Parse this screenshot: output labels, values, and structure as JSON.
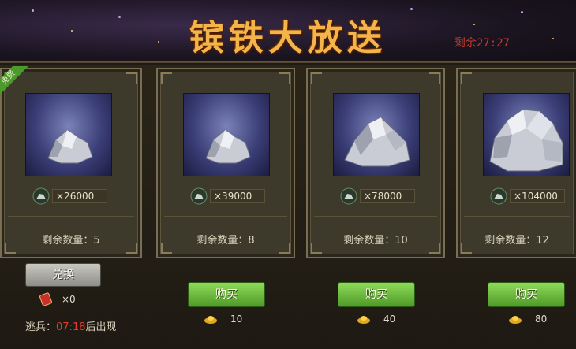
{
  "header": {
    "title": "镔铁大放送",
    "timer": "剩余27:27"
  },
  "cards": [
    {
      "price": "×26000",
      "remain": "剩余数量：5",
      "ribbon": "免费"
    },
    {
      "price": "×39000",
      "remain": "剩余数量：8"
    },
    {
      "price": "×78000",
      "remain": "剩余数量：10"
    },
    {
      "price": "×104000",
      "remain": "剩余数量：12"
    }
  ],
  "free_panel": {
    "exchange_label": "兑换",
    "token_count": "×0",
    "deserter_prefix": "逃兵：",
    "deserter_time": "07:18",
    "deserter_suffix": "后出现"
  },
  "buy": [
    {
      "label": "购买",
      "cost": "10"
    },
    {
      "label": "购买",
      "cost": "40"
    },
    {
      "label": "购买",
      "cost": "80"
    }
  ],
  "colors": {
    "title": "#f3b449",
    "timer": "#c7392b",
    "buy_button": "#6cbb3e",
    "deserter_time": "#e23a2e"
  },
  "icons": {
    "ore": "ore-icon",
    "gold": "gold-ingot-icon",
    "token": "token-icon"
  }
}
